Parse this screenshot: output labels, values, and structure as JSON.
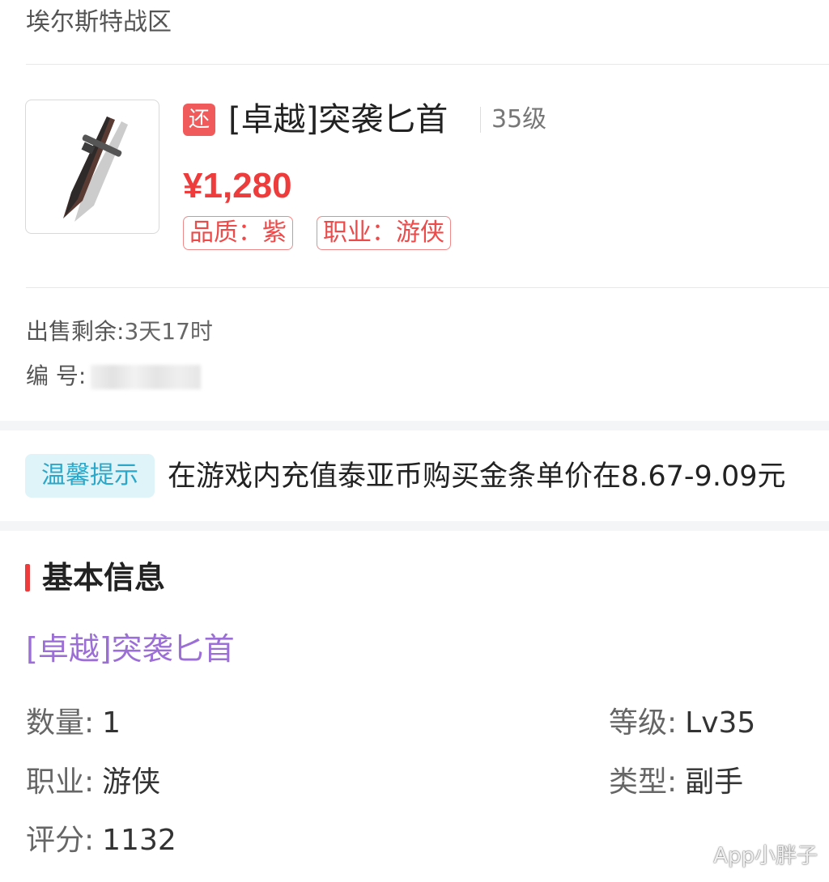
{
  "server": "埃尔斯特战区",
  "item": {
    "icon": "dagger-icon",
    "return_badge": "还",
    "name": "[卓越]突袭匕首",
    "level": "35级",
    "price": "¥1,280",
    "tags": {
      "quality": "品质：紫",
      "class": "职业：游侠"
    }
  },
  "sale": {
    "remaining_label": "出售剩余:",
    "remaining_value": "3天17时",
    "id_label": "编 号:"
  },
  "tip": {
    "badge": "温馨提示",
    "text": "在游戏内充值泰亚币购买金条单价在8.67-9.09元"
  },
  "basic_info": {
    "title": "基本信息",
    "item_name": "[卓越]突袭匕首",
    "fields": {
      "quantity": {
        "label": "数量:",
        "value": "1"
      },
      "level": {
        "label": "等级:",
        "value": "Lv35"
      },
      "class": {
        "label": "职业:",
        "value": "游侠"
      },
      "type": {
        "label": "类型:",
        "value": "副手"
      },
      "score": {
        "label": "评分:",
        "value": "1132"
      }
    }
  },
  "watermark": "App小胖子",
  "colors": {
    "price_red": "#ee3b3b",
    "tip_badge_bg": "#dff4f8",
    "tip_badge_text": "#2aa7c9",
    "purple_name": "#9b6fd6"
  }
}
